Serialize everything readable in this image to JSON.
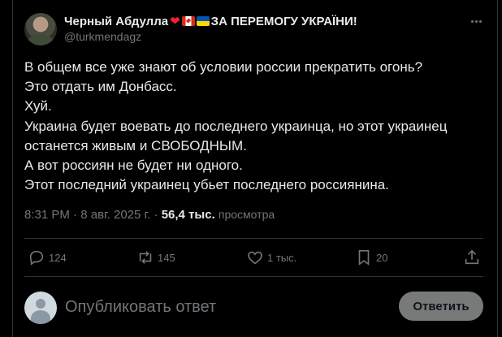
{
  "author": {
    "display_name": "Черный Абдулла",
    "banner_text": "ЗА ПЕРЕМОГУ УКРАЇНИ!",
    "handle": "@turkmendagz"
  },
  "tweet": {
    "lines": [
      "В общем все уже знают об условии россии прекратить огонь?",
      "Это отдать им Донбасс.",
      "Хуй.",
      "Украина будет воевать до последнего украинца, но этот украинец",
      "останется живым и СВОБОДНЫМ.",
      "А вот россиян не будет ни одного.",
      "Этот последний украинец убьет последнего россиянина."
    ],
    "time": "8:31 PM",
    "date": "8 авг. 2025 г.",
    "separator": "·",
    "views_count": "56,4 тыс.",
    "views_label": "просмотра"
  },
  "actions": {
    "replies": "124",
    "reposts": "145",
    "likes": "1 тыс.",
    "bookmarks": "20"
  },
  "reply_box": {
    "placeholder": "Опубликовать ответ",
    "button_label": "Ответить"
  },
  "colors": {
    "background": "#000000",
    "text_primary": "#e7e9ea",
    "text_secondary": "#71767b",
    "divider": "#2f3336",
    "reply_button_bg": "#787a7a",
    "heart": "#f4212e"
  },
  "icons": [
    "heart-emoji-icon",
    "canada-flag-icon",
    "ukraine-flag-icon",
    "more-icon",
    "reply-icon",
    "repost-icon",
    "like-icon",
    "bookmark-icon",
    "share-icon"
  ]
}
